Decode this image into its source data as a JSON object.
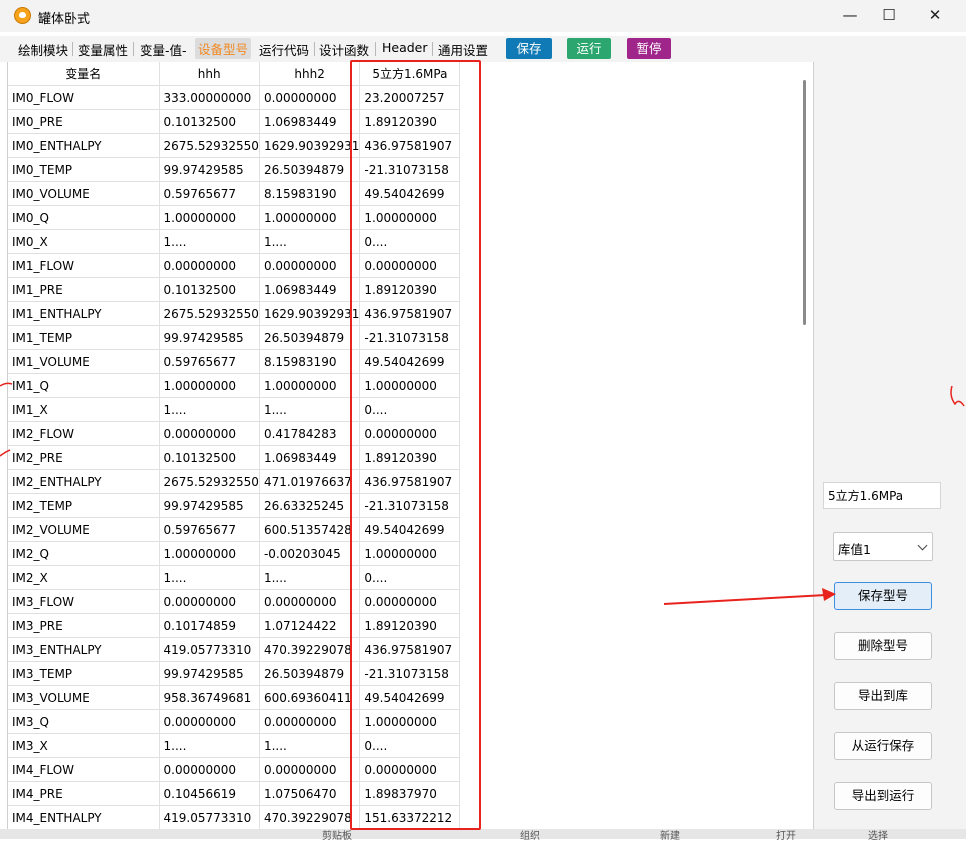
{
  "window": {
    "title": "罐体卧式",
    "minimize": "—",
    "maximize": "☐",
    "close": "✕"
  },
  "tabs": [
    "绘制模块",
    "变量属性",
    "变量-值-",
    "设备型号",
    "运行代码",
    "设计函数",
    "Header",
    "通用设置"
  ],
  "active_tab": "设备型号",
  "toolbar": {
    "save": "保存",
    "save_color": "#0f7ab5",
    "run": "运行",
    "run_color": "#2aa66e",
    "pause": "暂停",
    "pause_color": "#a0258a"
  },
  "table": {
    "headers": [
      "变量名",
      "hhh",
      "hhh2",
      "5立方1.6MPa"
    ],
    "rows": [
      [
        "IM0_FLOW",
        "333.00000000",
        "0.00000000",
        "23.20007257"
      ],
      [
        "IM0_PRE",
        "0.10132500",
        "1.06983449",
        "1.89120390"
      ],
      [
        "IM0_ENTHALPY",
        "2675.52932550",
        "1629.90392931",
        "436.97581907"
      ],
      [
        "IM0_TEMP",
        "99.97429585",
        "26.50394879",
        "-21.31073158"
      ],
      [
        "IM0_VOLUME",
        "0.59765677",
        "8.15983190",
        "49.54042699"
      ],
      [
        "IM0_Q",
        "1.00000000",
        "1.00000000",
        "1.00000000"
      ],
      [
        "IM0_X",
        "1....",
        "1....",
        "0...."
      ],
      [
        "IM1_FLOW",
        "0.00000000",
        "0.00000000",
        "0.00000000"
      ],
      [
        "IM1_PRE",
        "0.10132500",
        "1.06983449",
        "1.89120390"
      ],
      [
        "IM1_ENTHALPY",
        "2675.52932550",
        "1629.90392931",
        "436.97581907"
      ],
      [
        "IM1_TEMP",
        "99.97429585",
        "26.50394879",
        "-21.31073158"
      ],
      [
        "IM1_VOLUME",
        "0.59765677",
        "8.15983190",
        "49.54042699"
      ],
      [
        "IM1_Q",
        "1.00000000",
        "1.00000000",
        "1.00000000"
      ],
      [
        "IM1_X",
        "1....",
        "1....",
        "0...."
      ],
      [
        "IM2_FLOW",
        "0.00000000",
        "0.41784283",
        "0.00000000"
      ],
      [
        "IM2_PRE",
        "0.10132500",
        "1.06983449",
        "1.89120390"
      ],
      [
        "IM2_ENTHALPY",
        "2675.52932550",
        "471.01976637",
        "436.97581907"
      ],
      [
        "IM2_TEMP",
        "99.97429585",
        "26.63325245",
        "-21.31073158"
      ],
      [
        "IM2_VOLUME",
        "0.59765677",
        "600.51357428",
        "49.54042699"
      ],
      [
        "IM2_Q",
        "1.00000000",
        "-0.00203045",
        "1.00000000"
      ],
      [
        "IM2_X",
        "1....",
        "1....",
        "0...."
      ],
      [
        "IM3_FLOW",
        "0.00000000",
        "0.00000000",
        "0.00000000"
      ],
      [
        "IM3_PRE",
        "0.10174859",
        "1.07124422",
        "1.89120390"
      ],
      [
        "IM3_ENTHALPY",
        "419.05773310",
        "470.39229078",
        "436.97581907"
      ],
      [
        "IM3_TEMP",
        "99.97429585",
        "26.50394879",
        "-21.31073158"
      ],
      [
        "IM3_VOLUME",
        "958.36749681",
        "600.69360411",
        "49.54042699"
      ],
      [
        "IM3_Q",
        "0.00000000",
        "0.00000000",
        "1.00000000"
      ],
      [
        "IM3_X",
        "1....",
        "1....",
        "0...."
      ],
      [
        "IM4_FLOW",
        "0.00000000",
        "0.00000000",
        "0.00000000"
      ],
      [
        "IM4_PRE",
        "0.10456619",
        "1.07506470",
        "1.89837970"
      ],
      [
        "IM4_ENTHALPY",
        "419.05773310",
        "470.39229078",
        "151.63372212"
      ]
    ]
  },
  "right_panel": {
    "model_name_value": "5立方1.6MPa",
    "library_select": "库值1",
    "buttons": {
      "save_model": "保存型号",
      "delete_model": "删除型号",
      "export_to_library": "导出到库",
      "save_from_run": "从运行保存",
      "export_to_run": "导出到运行"
    }
  },
  "footer": [
    "剪贴板",
    "组织",
    "新建",
    "打开",
    "选择"
  ],
  "annotation_color": "#e8231d"
}
